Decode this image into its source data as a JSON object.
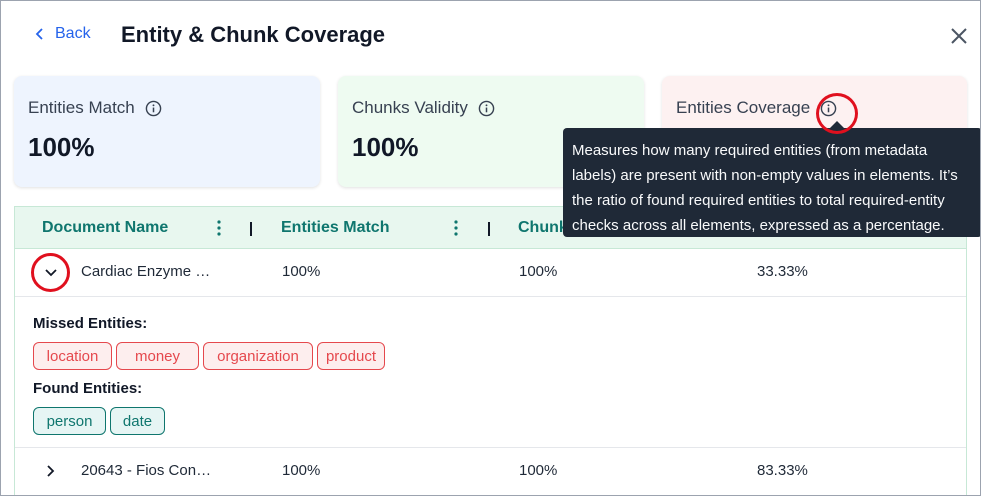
{
  "header": {
    "back_label": "Back",
    "title": "Entity & Chunk Coverage",
    "close_icon": "close-icon"
  },
  "cards": [
    {
      "label": "Entities Match",
      "value": "100%",
      "color": "#eef4fe"
    },
    {
      "label": "Chunks Validity",
      "value": "100%",
      "color": "#eefbf1"
    },
    {
      "label": "Entities Coverage",
      "value": "",
      "color": "#fdf1f1"
    }
  ],
  "tooltip": {
    "text": "Measures how many required entities (from metadata labels) are present with non-empty values in elements. It’s the ratio of found required entities to total required-entity checks across all elements, expressed as a percentage."
  },
  "table": {
    "columns": [
      "Document Name",
      "Entities Match",
      "Chunk"
    ],
    "rows": [
      {
        "name": "Cardiac Enzyme …",
        "entities_match": "100%",
        "chunks": "100%",
        "coverage": "33.33%",
        "expanded": true,
        "missed_label": "Missed Entities:",
        "missed": [
          "location",
          "money",
          "organization",
          "product"
        ],
        "found_label": "Found Entities:",
        "found": [
          "person",
          "date"
        ]
      },
      {
        "name": "20643 - Fios Con…",
        "entities_match": "100%",
        "chunks": "100%",
        "coverage": "83.33%",
        "expanded": false
      }
    ]
  },
  "colors": {
    "accent": "#2563eb",
    "header_text": "#0f766e",
    "missed": "#e5484d",
    "found": "#0f766e",
    "highlight": "#e0101e"
  }
}
